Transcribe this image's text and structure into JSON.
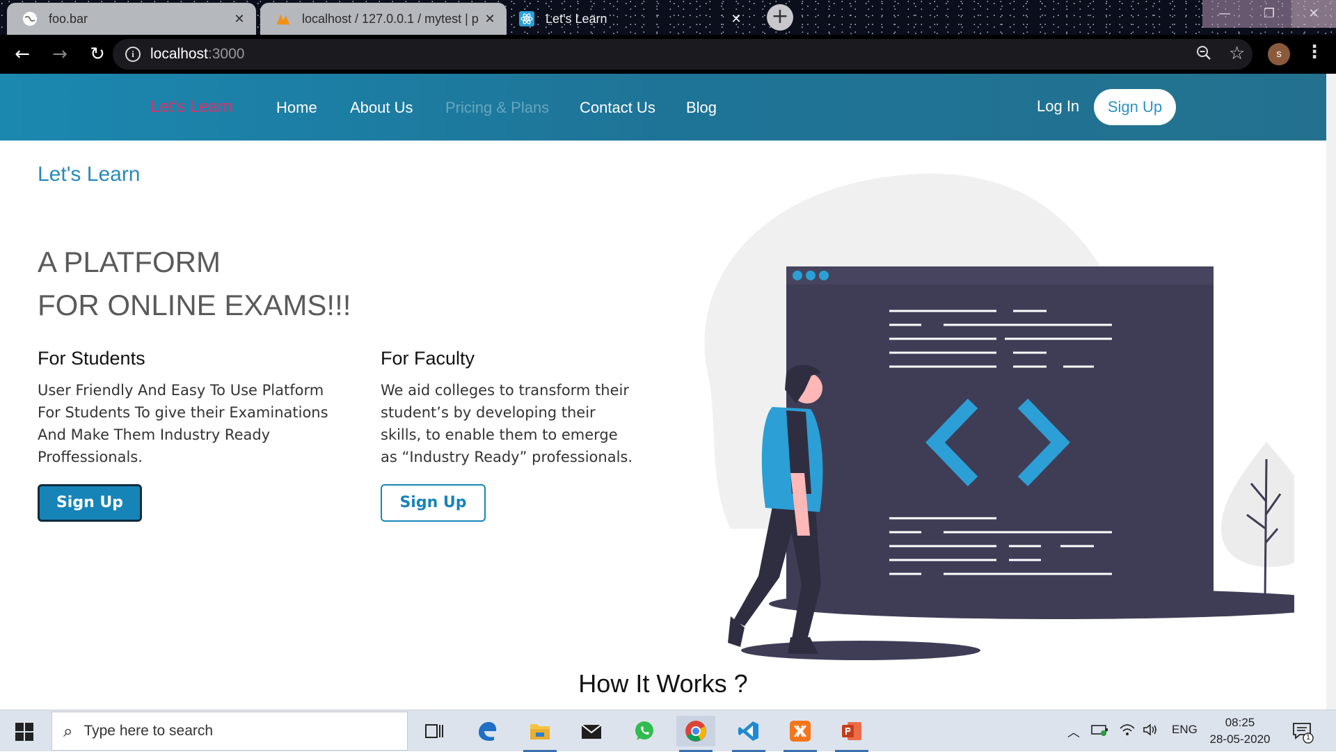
{
  "browser": {
    "tabs": [
      {
        "title": "foo.bar",
        "state": "inactive"
      },
      {
        "title": "localhost / 127.0.0.1 / mytest | p",
        "state": "inactive"
      },
      {
        "title": "Let's Learn",
        "state": "active"
      }
    ],
    "url_host": "localhost",
    "url_port": ":3000",
    "profile_initial": "s"
  },
  "navbar": {
    "brand": "Let's Learn",
    "links": [
      "Home",
      "About Us",
      "Pricing & Plans",
      "Contact Us",
      "Blog"
    ],
    "login": "Log In",
    "signup": "Sign Up"
  },
  "main": {
    "page_title": "Let's Learn",
    "hero_line1": "A PLATFORM",
    "hero_line2": "FOR ONLINE EXAMS!!!",
    "students": {
      "heading": "For Students",
      "text": "User Friendly And Easy To Use Platform For Students To give their Examinations And Make Them Industry Ready Proffessionals.",
      "button": "Sign Up"
    },
    "faculty": {
      "heading": "For Faculty",
      "text": "We aid colleges to transform their student’s by developing their skills, to enable them to emerge as “Industry Ready” professionals.",
      "button": "Sign Up"
    },
    "section_heading": "How It Works ?"
  },
  "taskbar": {
    "search_placeholder": "Type here to search",
    "language": "ENG",
    "time": "08:25",
    "date": "28-05-2020",
    "notification_count": "1"
  },
  "colors": {
    "navbar": "#1e7ea3",
    "brand": "#d7336a",
    "accent": "#1784b8",
    "illustration_dark": "#3f3d56"
  }
}
